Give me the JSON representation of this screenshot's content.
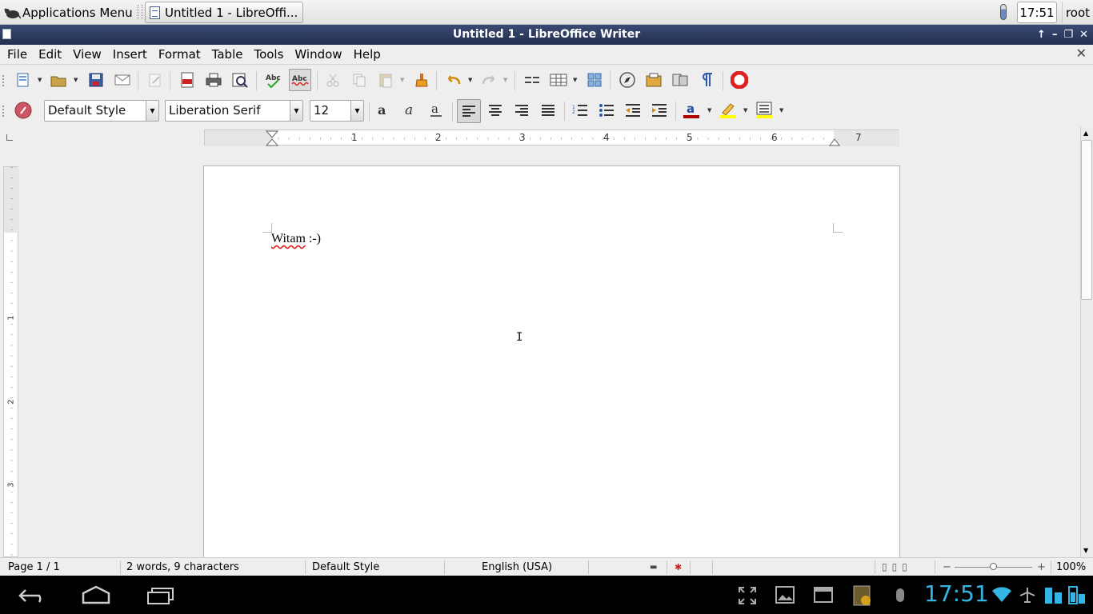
{
  "taskbar": {
    "apps_menu_label": "Applications Menu",
    "task_button_label": "Untitled 1 - LibreOffi...",
    "clock": "17:51",
    "user": "root"
  },
  "window": {
    "title": "Untitled 1 - LibreOffice Writer",
    "controls": [
      "↑",
      "–",
      "❐",
      "✕"
    ]
  },
  "menubar": {
    "items": [
      "File",
      "Edit",
      "View",
      "Insert",
      "Format",
      "Table",
      "Tools",
      "Window",
      "Help"
    ],
    "close_doc": "✕"
  },
  "format_toolbar": {
    "paragraph_style": "Default Style",
    "font_name": "Liberation Serif",
    "font_size": "12"
  },
  "ruler": {
    "h_numbers": [
      "1",
      "2",
      "3",
      "4",
      "5",
      "6",
      "7"
    ],
    "v_numbers": [
      "1",
      "2",
      "3"
    ]
  },
  "document": {
    "text_word": "Witam",
    "text_rest": " :-)"
  },
  "statusbar": {
    "page": "Page 1 / 1",
    "word_count": "2 words, 9 characters",
    "page_style": "Default Style",
    "language": "English (USA)",
    "zoom": "100%"
  },
  "android": {
    "clock": "17:51"
  },
  "colors": {
    "titlebar": "#2d3a5e",
    "android_clock": "#33b5e5",
    "font_color": "#b00000",
    "highlight": "#ffff00"
  }
}
